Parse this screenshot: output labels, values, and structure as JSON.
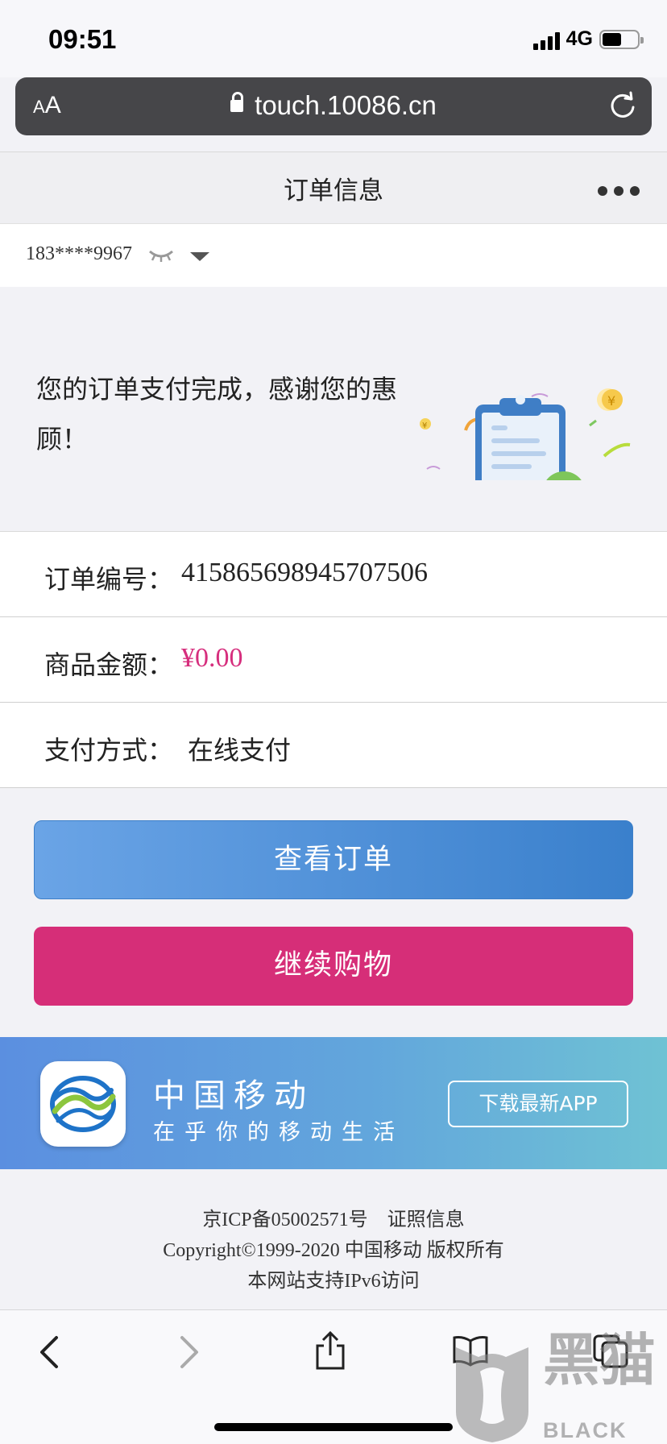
{
  "status_bar": {
    "time": "09:51",
    "network": "4G"
  },
  "browser": {
    "text_size_label": "AA",
    "url": "touch.10086.cn"
  },
  "header": {
    "title": "订单信息"
  },
  "account": {
    "phone": "183****9967"
  },
  "hero": {
    "message": "您的订单支付完成，感谢您的惠顾！"
  },
  "order": {
    "number_label": "订单编号：",
    "number_value": "415865698945707506",
    "amount_label": "商品金额：",
    "amount_value": "¥0.00",
    "payment_label": "支付方式：",
    "payment_value": "在线支付"
  },
  "buttons": {
    "view_order": "查看订单",
    "continue_shopping": "继续购物"
  },
  "banner": {
    "brand": "中国移动",
    "slogan": "在乎你的移动生活",
    "download": "下载最新APP"
  },
  "footer": {
    "icp": "京ICP备05002571号",
    "license": "证照信息",
    "copyright": "Copyright©1999-2020 中国移动 版权所有",
    "ipv6": "本网站支持IPv6访问"
  },
  "watermark": {
    "text": "黑猫",
    "sub": "BLACK CAT"
  },
  "colors": {
    "price": "#d62e7d",
    "primary_button": "#3a80cc",
    "secondary_button": "#d62e78"
  }
}
